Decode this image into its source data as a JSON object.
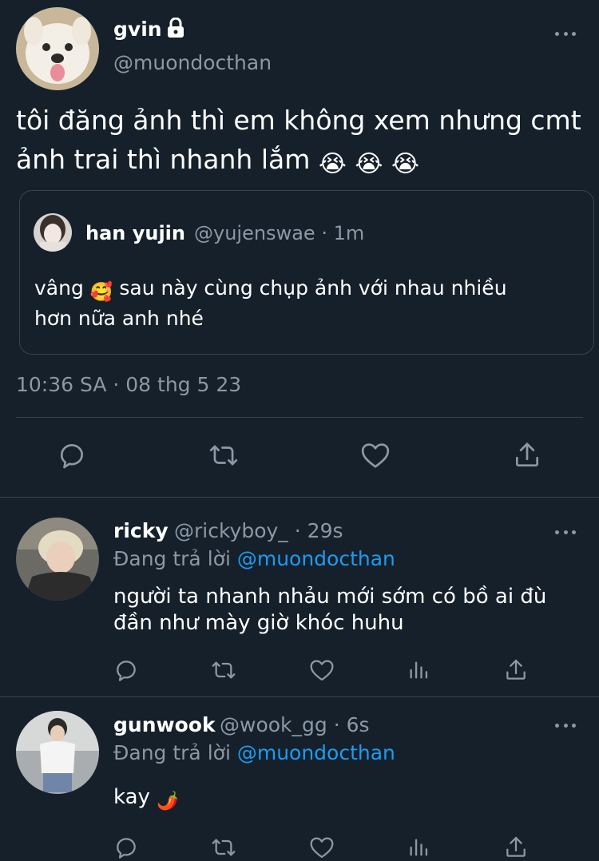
{
  "main_tweet": {
    "author_name": "gvin",
    "handle": "@muondocthan",
    "text_line1": "tôi đăng ảnh thì em không xem nhưng cmt",
    "text_line2": "ảnh trai thì nhanh lắm",
    "emoji": "😭",
    "timestamp": "10:36 SA · 08 thg 5 23",
    "locked_icon": "lock-icon",
    "quote": {
      "author_name": "han yujin",
      "handle": "@yujenswae",
      "time": "· 1m",
      "text_part1": "vâng",
      "emoji": "🥰",
      "text_part2": "sau này cùng chụp ảnh với nhau nhiều",
      "text_line2": "hơn nữa anh nhé"
    },
    "actions": [
      "reply-icon",
      "retweet-icon",
      "like-icon",
      "share-icon"
    ]
  },
  "replies": [
    {
      "author_name": "ricky",
      "handle": "@rickyboy_",
      "time": "· 29s",
      "replying_prefix": "Đang trả lời",
      "replying_to": "@muondocthan",
      "text_line1": "người ta nhanh nhảu mới sớm có bồ ai đù",
      "text_line2": "đần như mày giờ khóc huhu"
    },
    {
      "author_name": "gunwook",
      "handle": "@wook_gg",
      "time": "· 6s",
      "replying_prefix": "Đang trả lời",
      "replying_to": "@muondocthan",
      "text_line1": "kay",
      "emoji": "🌶️"
    }
  ],
  "colors": {
    "background": "#15202b",
    "text": "#ffffff",
    "secondary": "#8b98a5",
    "link": "#1d9bf0",
    "border": "#38444d"
  }
}
